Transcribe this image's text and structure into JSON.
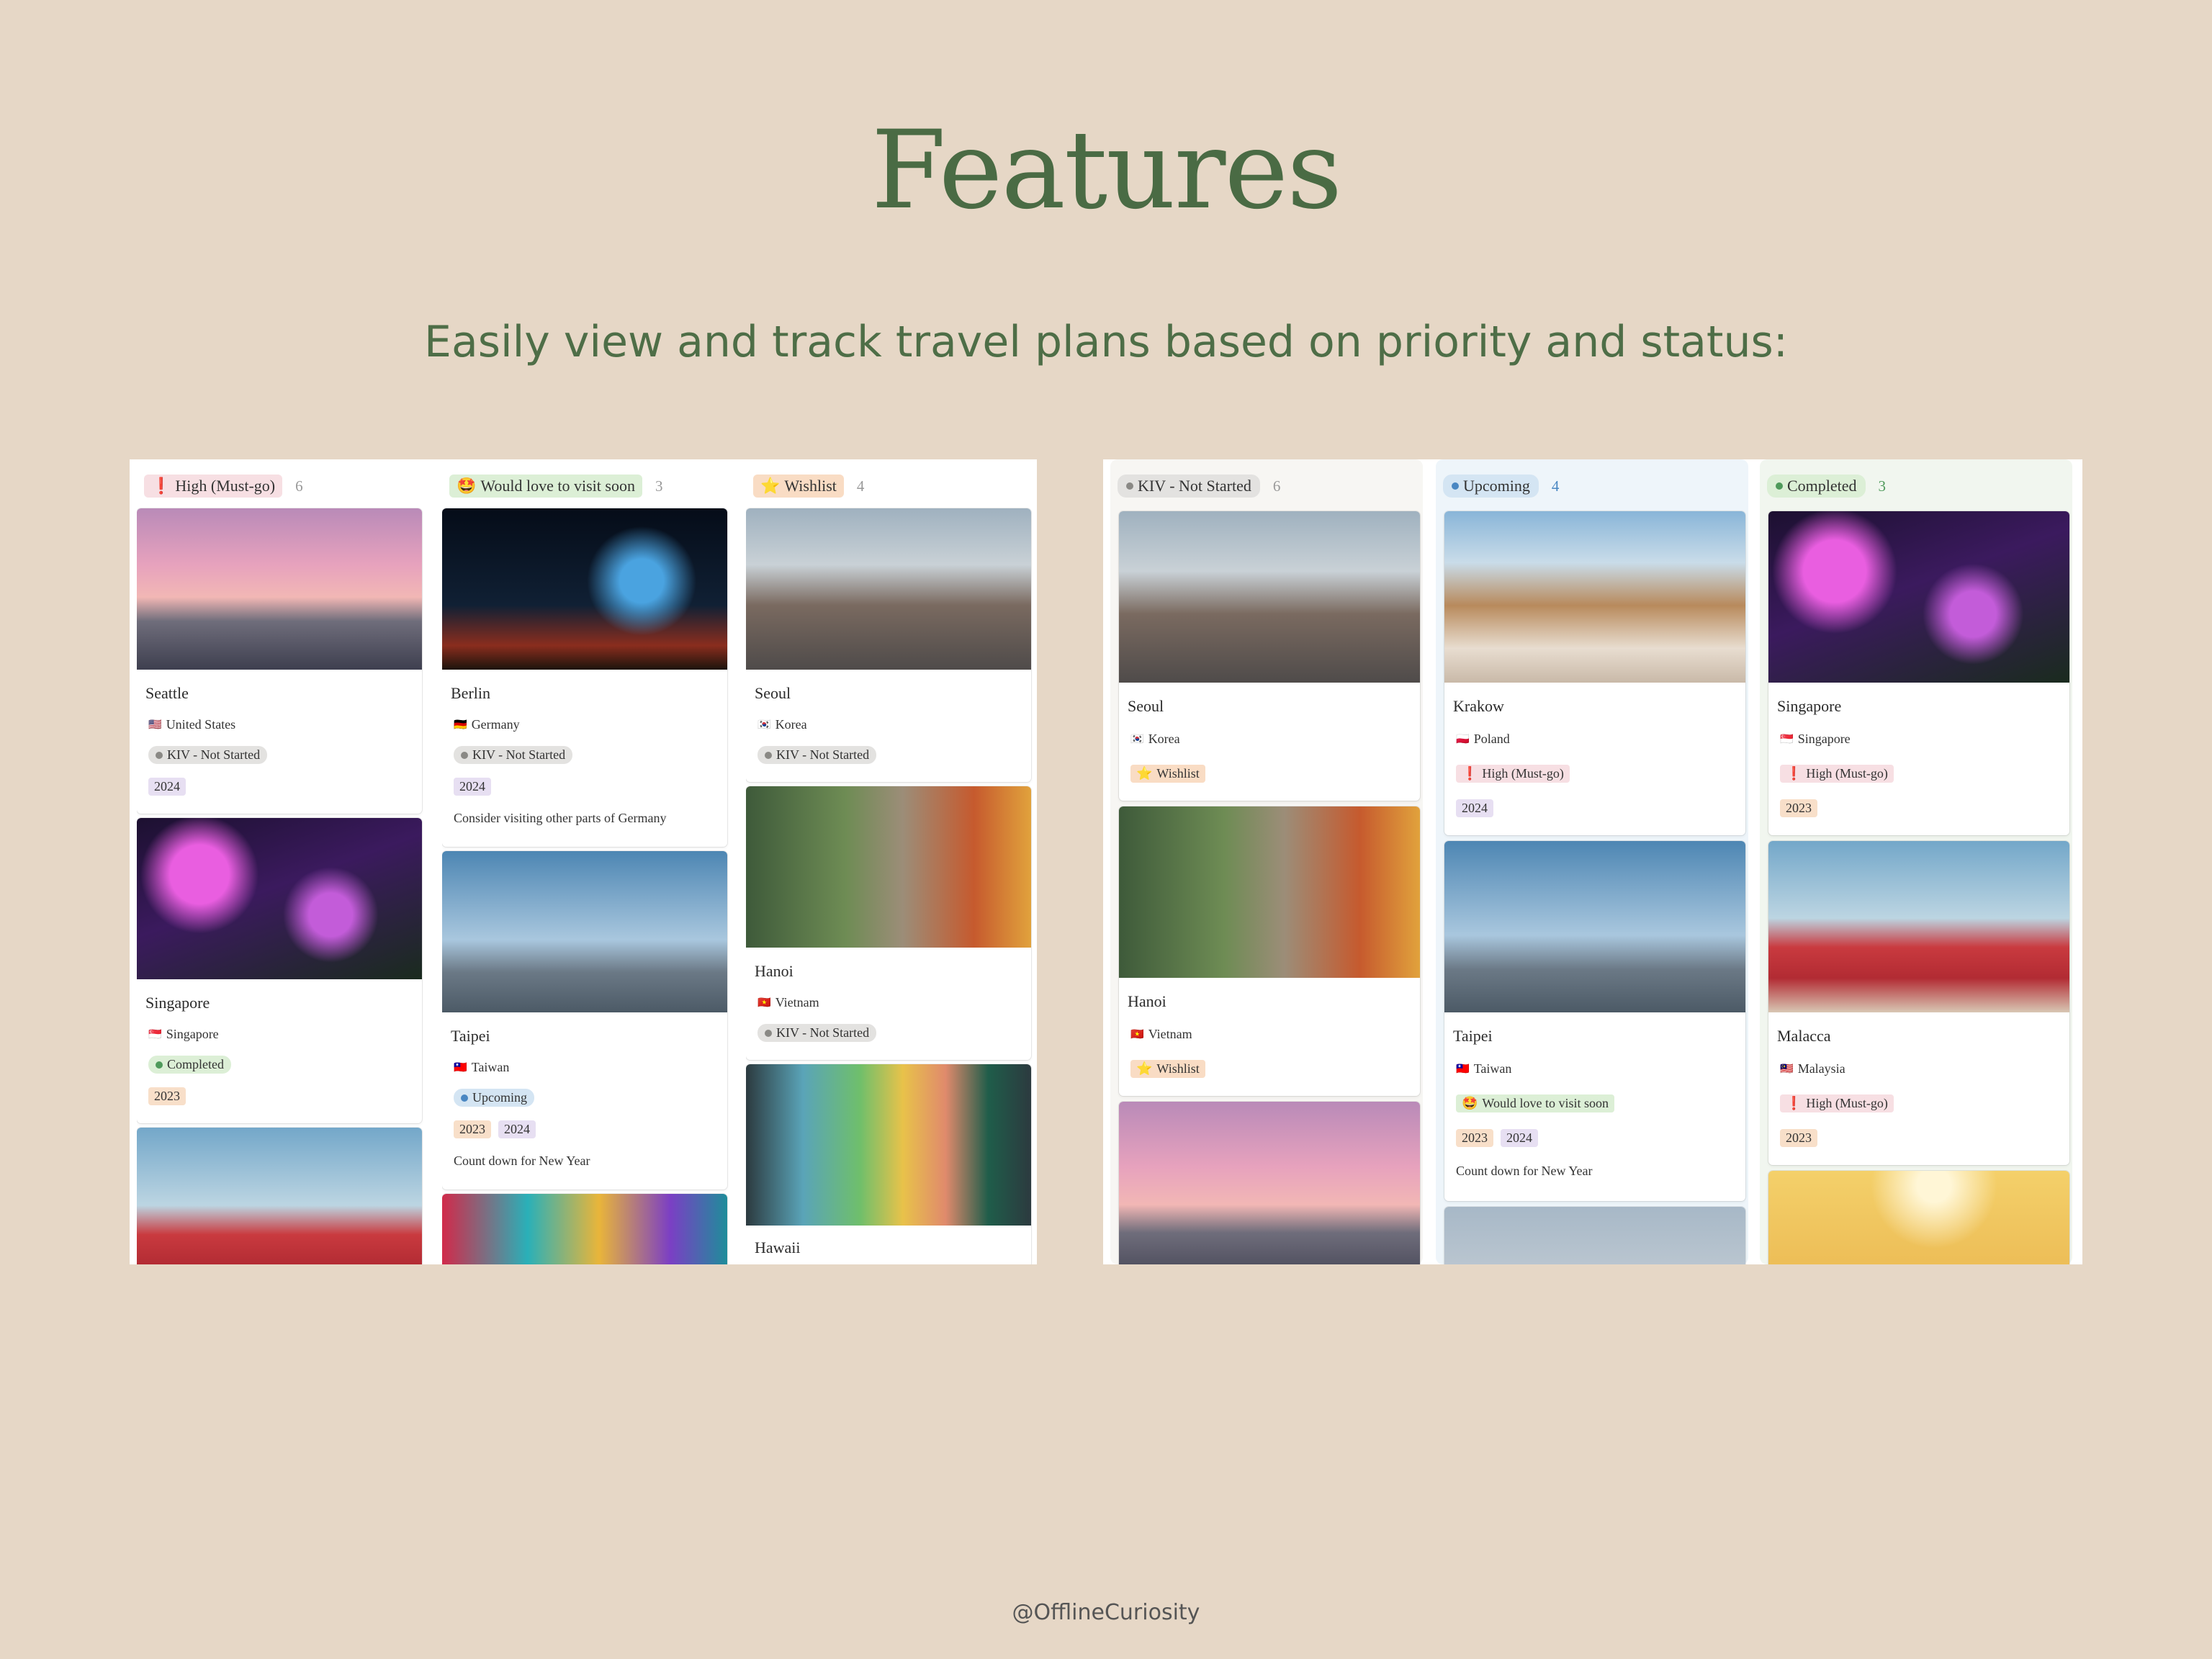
{
  "page": {
    "title": "Features",
    "subtitle": "Easily view and track travel plans based on priority and status:",
    "footer": "@OfflineCuriosity"
  },
  "colors": {
    "background": "#e6d7c6",
    "heading": "#4a6b44",
    "priority_high": "#f7dfe3",
    "priority_soon": "#dcefd6",
    "priority_wishlist": "#f9dcc4",
    "status_kiv": "#e3e2e0",
    "status_upcoming": "#d4e5f3",
    "status_completed": "#dcefd6",
    "year_2024": "#e7dff2",
    "year_2023": "#f8dfc9"
  },
  "left_board": {
    "columns": [
      {
        "label": "High (Must-go)",
        "icon": "exclamation-icon",
        "count": "6",
        "cards": [
          {
            "title": "Seattle",
            "country": "United States",
            "status": "KIV - Not Started",
            "years": [
              "2024"
            ]
          },
          {
            "title": "Singapore",
            "country": "Singapore",
            "status": "Completed",
            "years": [
              "2023"
            ]
          },
          {
            "title": "",
            "country": "",
            "status": "",
            "years": []
          }
        ]
      },
      {
        "label": "Would love to visit soon",
        "icon": "star-struck-emoji-icon",
        "count": "3",
        "cards": [
          {
            "title": "Berlin",
            "country": "Germany",
            "status": "KIV - Not Started",
            "years": [
              "2024"
            ],
            "note": "Consider visiting other parts of Germany"
          },
          {
            "title": "Taipei",
            "country": "Taiwan",
            "status": "Upcoming",
            "years": [
              "2023",
              "2024"
            ],
            "note": "Count down for New Year"
          },
          {
            "title": "",
            "country": "",
            "status": "",
            "years": []
          }
        ]
      },
      {
        "label": "Wishlist",
        "icon": "star-icon",
        "count": "4",
        "cards": [
          {
            "title": "Seoul",
            "country": "Korea",
            "status": "KIV - Not Started",
            "years": []
          },
          {
            "title": "Hanoi",
            "country": "Vietnam",
            "status": "KIV - Not Started",
            "years": []
          },
          {
            "title": "Hawaii",
            "country": "",
            "status": "",
            "years": []
          }
        ]
      }
    ]
  },
  "right_board": {
    "columns": [
      {
        "label": "KIV - Not Started",
        "count": "6",
        "cards": [
          {
            "title": "Seoul",
            "country": "Korea",
            "priority": "Wishlist",
            "years": []
          },
          {
            "title": "Hanoi",
            "country": "Vietnam",
            "priority": "Wishlist",
            "years": []
          },
          {
            "title": "",
            "country": "",
            "priority": "",
            "years": []
          }
        ]
      },
      {
        "label": "Upcoming",
        "count": "4",
        "cards": [
          {
            "title": "Krakow",
            "country": "Poland",
            "priority": "High (Must-go)",
            "years": [
              "2024"
            ]
          },
          {
            "title": "Taipei",
            "country": "Taiwan",
            "priority": "Would love to visit soon",
            "years": [
              "2023",
              "2024"
            ],
            "note": "Count down for New Year"
          },
          {
            "title": "",
            "country": "",
            "priority": "",
            "years": []
          }
        ]
      },
      {
        "label": "Completed",
        "count": "3",
        "cards": [
          {
            "title": "Singapore",
            "country": "Singapore",
            "priority": "High (Must-go)",
            "years": [
              "2023"
            ]
          },
          {
            "title": "Malacca",
            "country": "Malaysia",
            "priority": "High (Must-go)",
            "years": [
              "2023"
            ]
          },
          {
            "title": "",
            "country": "",
            "priority": "",
            "years": []
          }
        ]
      }
    ]
  }
}
